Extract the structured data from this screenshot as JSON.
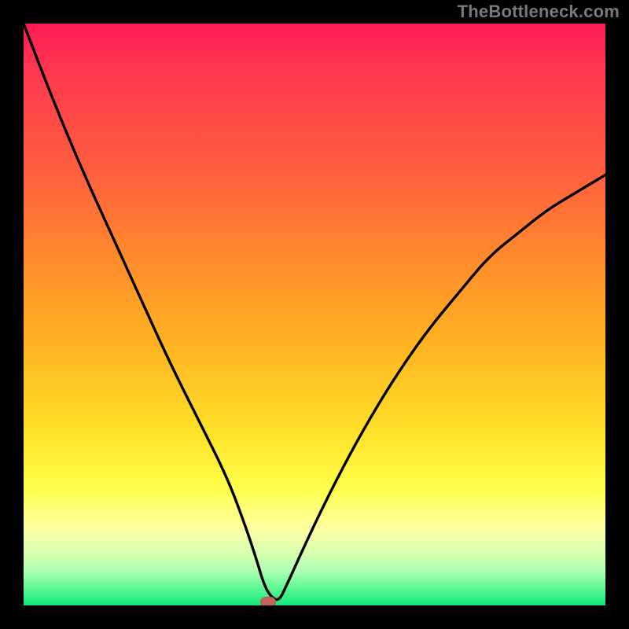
{
  "watermark": "TheBottleneck.com",
  "chart_data": {
    "type": "line",
    "title": "",
    "xlabel": "",
    "ylabel": "",
    "xlim": [
      0,
      100
    ],
    "ylim": [
      0,
      100
    ],
    "grid": false,
    "series": [
      {
        "name": "curve",
        "x": [
          0,
          5,
          10,
          15,
          20,
          25,
          30,
          35,
          38,
          40,
          41.5,
          43,
          44,
          45,
          50,
          55,
          60,
          65,
          70,
          75,
          80,
          85,
          90,
          95,
          100
        ],
        "y": [
          100,
          87,
          75,
          64,
          53,
          42,
          32,
          22,
          14,
          8,
          3,
          1,
          1,
          3,
          14,
          24,
          33,
          41,
          48,
          54,
          60,
          64,
          68,
          71,
          74
        ]
      }
    ],
    "marker": {
      "x": 42,
      "y": 0.5
    },
    "colors": {
      "curve": "#000000",
      "marker": "#c6635a",
      "gradient_stops": [
        "#ff1a55",
        "#ff5d3f",
        "#ffb321",
        "#ffe028",
        "#ffff4c",
        "#6cf99a",
        "#0fe979"
      ]
    }
  }
}
